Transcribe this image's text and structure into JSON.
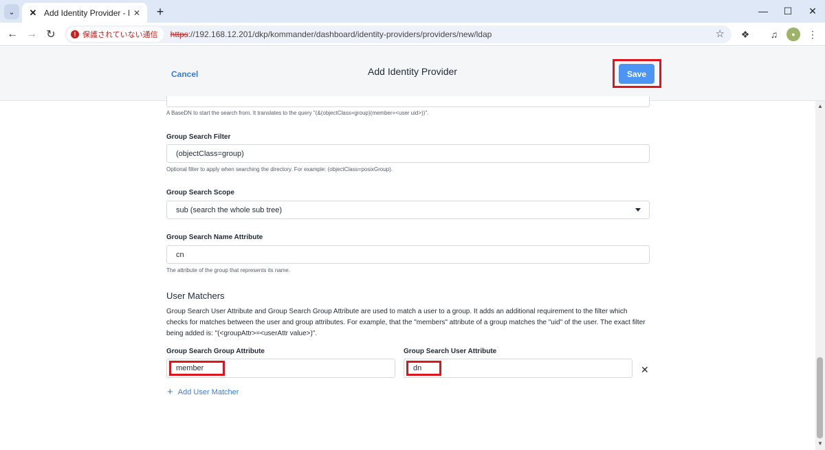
{
  "browser": {
    "tab_title": "Add Identity Provider - Nutanix",
    "security_label": "保護されていない通信",
    "url_scheme": "https",
    "url_rest": "://192.168.12.201/dkp/kommander/dashboard/identity-providers/providers/new/ldap"
  },
  "header": {
    "cancel_label": "Cancel",
    "title": "Add Identity Provider",
    "save_label": "Save"
  },
  "form": {
    "base_dn_helper": "A BaseDN to start the search from. It translates to the query \"(&(objectClass=group)(member=<user uid>))\".",
    "group_search_filter": {
      "label": "Group Search Filter",
      "value": "(objectClass=group)",
      "helper": "Optional filter to apply when searching the directory. For example: (objectClass=posixGroup)."
    },
    "group_search_scope": {
      "label": "Group Search Scope",
      "value": "sub (search the whole sub tree)"
    },
    "group_search_name_attribute": {
      "label": "Group Search Name Attribute",
      "value": "cn",
      "helper": "The attribute of the group that represents its name."
    },
    "user_matchers": {
      "title": "User Matchers",
      "description": "Group Search User Attribute and Group Search Group Attribute are used to match a user to a group. It adds an additional requirement to the filter which checks for matches between the user and group attributes. For example, that the \"members\" attribute of a group matches the \"uid\" of the user. The exact filter being added is: \"(<groupAttr>=<userAttr value>)\".",
      "group_attribute_label": "Group Search Group Attribute",
      "group_attribute_value": "member",
      "user_attribute_label": "Group Search User Attribute",
      "user_attribute_value": "dn",
      "add_label": "Add User Matcher"
    }
  },
  "colors": {
    "accent": "#4c95f5",
    "link": "#3b7ddd",
    "highlight": "#e0141c"
  }
}
